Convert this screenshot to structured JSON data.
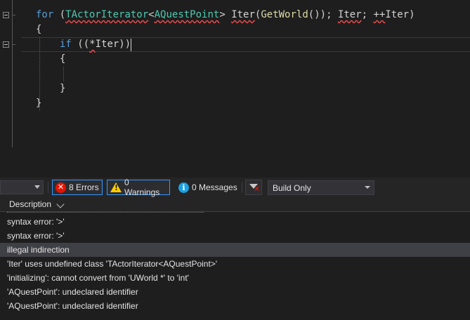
{
  "editor": {
    "lines": [
      {
        "tokens": [
          {
            "t": "for",
            "c": "kw"
          },
          {
            "t": " (",
            "c": ""
          },
          {
            "t": "TActorIterator",
            "c": "type squiggle"
          },
          {
            "t": "<",
            "c": ""
          },
          {
            "t": "AQuestPoint",
            "c": "type squiggle"
          },
          {
            "t": "> ",
            "c": ""
          },
          {
            "t": "Iter",
            "c": "squiggle"
          },
          {
            "t": "(",
            "c": ""
          },
          {
            "t": "GetWorld",
            "c": "fn"
          },
          {
            "t": "()); ",
            "c": ""
          },
          {
            "t": "Iter",
            "c": "squiggle"
          },
          {
            "t": "; ",
            "c": ""
          },
          {
            "t": "++",
            "c": "squiggle"
          },
          {
            "t": "Iter",
            "c": ""
          },
          {
            "t": ")",
            "c": ""
          }
        ]
      },
      {
        "tokens": [
          {
            "t": "{",
            "c": ""
          }
        ]
      },
      {
        "tokens": [
          {
            "t": "if",
            "c": "kw"
          },
          {
            "t": " ((",
            "c": ""
          },
          {
            "t": "*",
            "c": "squiggle"
          },
          {
            "t": "Iter))",
            "c": ""
          }
        ]
      },
      {
        "tokens": [
          {
            "t": "{",
            "c": ""
          }
        ]
      },
      {
        "tokens": []
      },
      {
        "tokens": [
          {
            "t": "}",
            "c": ""
          }
        ]
      },
      {
        "tokens": [
          {
            "t": "}",
            "c": ""
          }
        ]
      }
    ]
  },
  "toolbar": {
    "errors_label": "8 Errors",
    "warnings_label": "0 Warnings",
    "messages_label": "0 Messages",
    "build_filter": "Build Only"
  },
  "list": {
    "header": "Description",
    "rows": [
      {
        "text": "syntax error: '>'",
        "selected": false
      },
      {
        "text": "syntax error: '>'",
        "selected": false
      },
      {
        "text": "illegal indirection",
        "selected": true
      },
      {
        "text": "'Iter' uses undefined class 'TActorIterator<AQuestPoint>'",
        "selected": false
      },
      {
        "text": "'initializing': cannot convert from 'UWorld *' to 'int'",
        "selected": false
      },
      {
        "text": "'AQuestPoint': undeclared identifier",
        "selected": false
      },
      {
        "text": "'AQuestPoint': undeclared identifier",
        "selected": false
      }
    ]
  },
  "colors": {
    "keyword": "#569cd6",
    "type": "#4ec9b0",
    "function": "#dcdcaa",
    "error_squiggle": "#f14c4c",
    "active_border": "#3399ff"
  }
}
